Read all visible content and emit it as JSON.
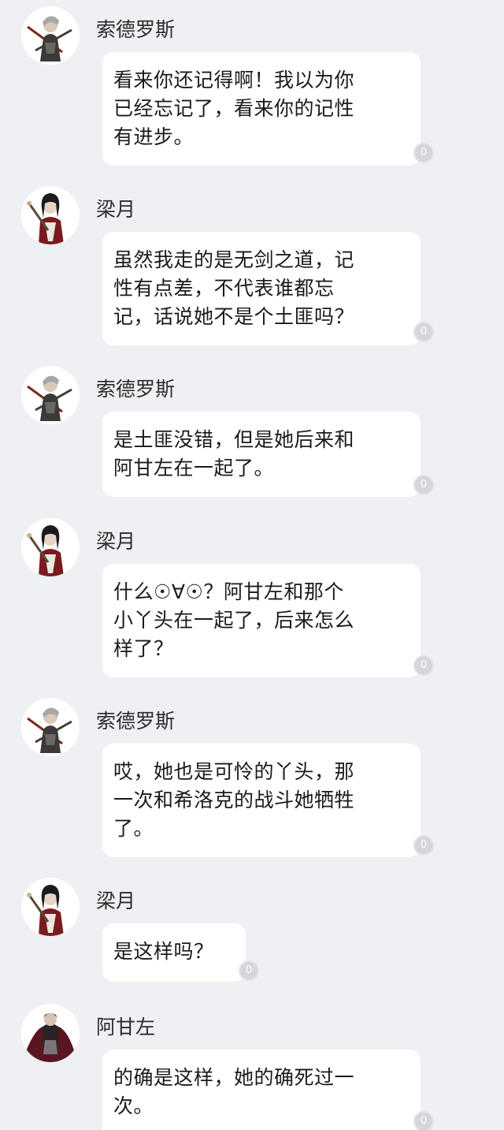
{
  "messages": [
    {
      "sender": "索德罗斯",
      "avatar": "warrior-gray-avatar-icon",
      "lines": [
        "看来你还记得啊！我以为你",
        "已经忘记了，看来你的记性",
        "有进步。"
      ],
      "badge": "0"
    },
    {
      "sender": "梁月",
      "avatar": "swordswoman-red-avatar-icon",
      "lines": [
        "虽然我走的是无剑之道，记",
        "性有点差，不代表谁都忘",
        "记，话说她不是个土匪吗？"
      ],
      "badge": "0"
    },
    {
      "sender": "索德罗斯",
      "avatar": "warrior-gray-avatar-icon",
      "lines": [
        "是土匪没错，但是她后来和",
        "阿甘左在一起了。"
      ],
      "badge": "0"
    },
    {
      "sender": "梁月",
      "avatar": "swordswoman-red-avatar-icon",
      "lines": [
        "什么☉∀☉？阿甘左和那个",
        "小丫头在一起了，后来怎么",
        "样了？"
      ],
      "badge": "0"
    },
    {
      "sender": "索德罗斯",
      "avatar": "warrior-gray-avatar-icon",
      "lines": [
        "哎，她也是可怜的丫头，那",
        "一次和希洛克的战斗她牺牲",
        "了。"
      ],
      "badge": "0"
    },
    {
      "sender": "梁月",
      "avatar": "swordswoman-red-avatar-icon",
      "lines": [
        "是这样吗？"
      ],
      "badge": "0"
    },
    {
      "sender": "阿甘左",
      "avatar": "swordsman-dark-avatar-icon",
      "lines": [
        "的确是这样，她的确死过一",
        "次。"
      ],
      "badge": "0"
    }
  ]
}
